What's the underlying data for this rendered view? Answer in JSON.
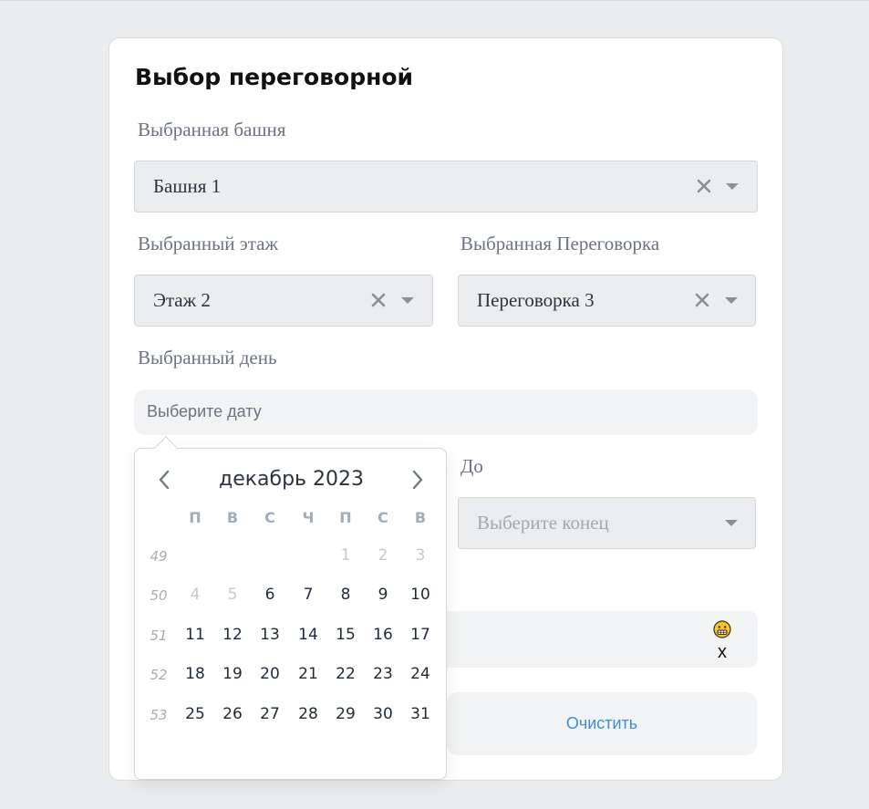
{
  "card": {
    "title": "Выбор переговорной"
  },
  "tower": {
    "label": "Выбранная башня",
    "value": "Башня 1"
  },
  "floor": {
    "label": "Выбранный этаж",
    "value": "Этаж 2"
  },
  "room": {
    "label": "Выбранная Переговорка",
    "value": "Переговорка 3"
  },
  "day": {
    "label": "Выбранный день",
    "placeholder": "Выберите дату"
  },
  "end": {
    "label": "До",
    "placeholder": "Выберите конец"
  },
  "emoji_field": {
    "x_label": "x"
  },
  "clear_button": {
    "label": "Очистить"
  },
  "calendar": {
    "month": "декабрь 2023",
    "weekdays": [
      "П",
      "В",
      "С",
      "Ч",
      "П",
      "С",
      "В"
    ],
    "weeks": [
      {
        "num": "49",
        "days": [
          {
            "d": "",
            "m": false
          },
          {
            "d": "",
            "m": false
          },
          {
            "d": "",
            "m": false
          },
          {
            "d": "",
            "m": false
          },
          {
            "d": "1",
            "m": true
          },
          {
            "d": "2",
            "m": true
          },
          {
            "d": "3",
            "m": true
          }
        ]
      },
      {
        "num": "50",
        "days": [
          {
            "d": "4",
            "m": true
          },
          {
            "d": "5",
            "m": true
          },
          {
            "d": "6",
            "m": false
          },
          {
            "d": "7",
            "m": false
          },
          {
            "d": "8",
            "m": false
          },
          {
            "d": "9",
            "m": false
          },
          {
            "d": "10",
            "m": false
          }
        ]
      },
      {
        "num": "51",
        "days": [
          {
            "d": "11",
            "m": false
          },
          {
            "d": "12",
            "m": false
          },
          {
            "d": "13",
            "m": false
          },
          {
            "d": "14",
            "m": false
          },
          {
            "d": "15",
            "m": false
          },
          {
            "d": "16",
            "m": false
          },
          {
            "d": "17",
            "m": false
          }
        ]
      },
      {
        "num": "52",
        "days": [
          {
            "d": "18",
            "m": false
          },
          {
            "d": "19",
            "m": false
          },
          {
            "d": "20",
            "m": false
          },
          {
            "d": "21",
            "m": false
          },
          {
            "d": "22",
            "m": false
          },
          {
            "d": "23",
            "m": false
          },
          {
            "d": "24",
            "m": false
          }
        ]
      },
      {
        "num": "53",
        "days": [
          {
            "d": "25",
            "m": false
          },
          {
            "d": "26",
            "m": false
          },
          {
            "d": "27",
            "m": false
          },
          {
            "d": "28",
            "m": false
          },
          {
            "d": "29",
            "m": false
          },
          {
            "d": "30",
            "m": false
          },
          {
            "d": "31",
            "m": false
          }
        ]
      }
    ]
  },
  "colors": {
    "accent": "#3a8fd8",
    "field_bg": "#ecedef",
    "page_bg": "#ebecee"
  }
}
